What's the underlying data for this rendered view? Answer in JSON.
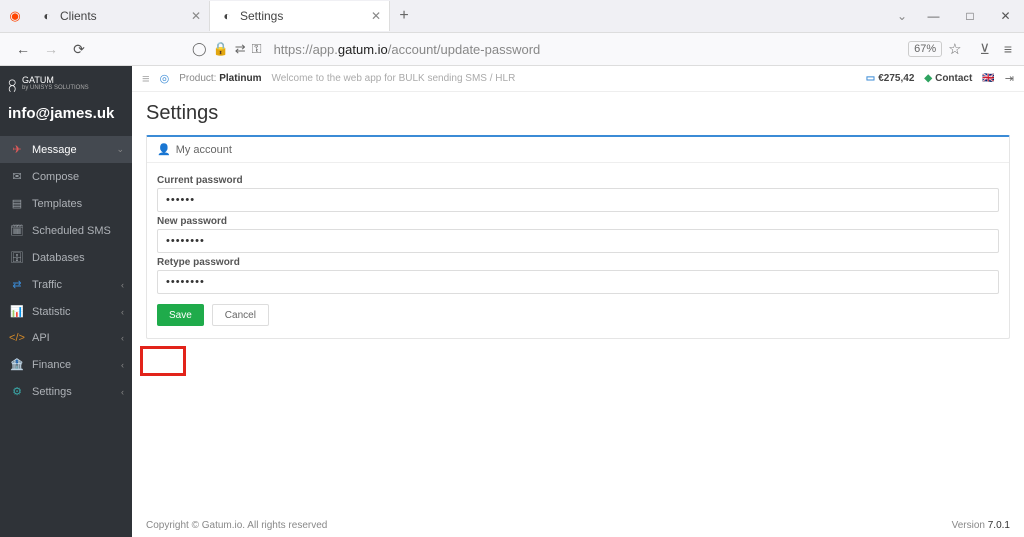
{
  "browser": {
    "tabs": [
      {
        "title": "Clients"
      },
      {
        "title": "Settings"
      }
    ],
    "url_prefix": "https://app.",
    "url_domain": "gatum.io",
    "url_path": "/account/update-password",
    "zoom": "67%"
  },
  "sidebar": {
    "brand_top": "GATUM",
    "brand_sub": "by UNISYS SOLUTIONS",
    "user": "info@james.uk",
    "items": [
      {
        "label": "Message"
      },
      {
        "label": "Compose"
      },
      {
        "label": "Templates"
      },
      {
        "label": "Scheduled SMS"
      },
      {
        "label": "Databases"
      },
      {
        "label": "Traffic"
      },
      {
        "label": "Statistic"
      },
      {
        "label": "API"
      },
      {
        "label": "Finance"
      },
      {
        "label": "Settings"
      }
    ]
  },
  "topbar": {
    "product_label": "Product:",
    "product_name": "Platinum",
    "welcome": "Welcome to the web app for BULK sending SMS / HLR",
    "balance": "€275,42",
    "contact": "Contact"
  },
  "page": {
    "title": "Settings",
    "panel_title": "My account",
    "labels": {
      "current": "Current password",
      "new": "New password",
      "retype": "Retype password"
    },
    "values": {
      "current": "••••••",
      "new": "••••••••",
      "retype": "••••••••"
    },
    "buttons": {
      "save": "Save",
      "cancel": "Cancel"
    }
  },
  "footer": {
    "copyright": "Copyright © Gatum.io. All rights reserved",
    "version_label": "Version ",
    "version": "7.0.1"
  }
}
